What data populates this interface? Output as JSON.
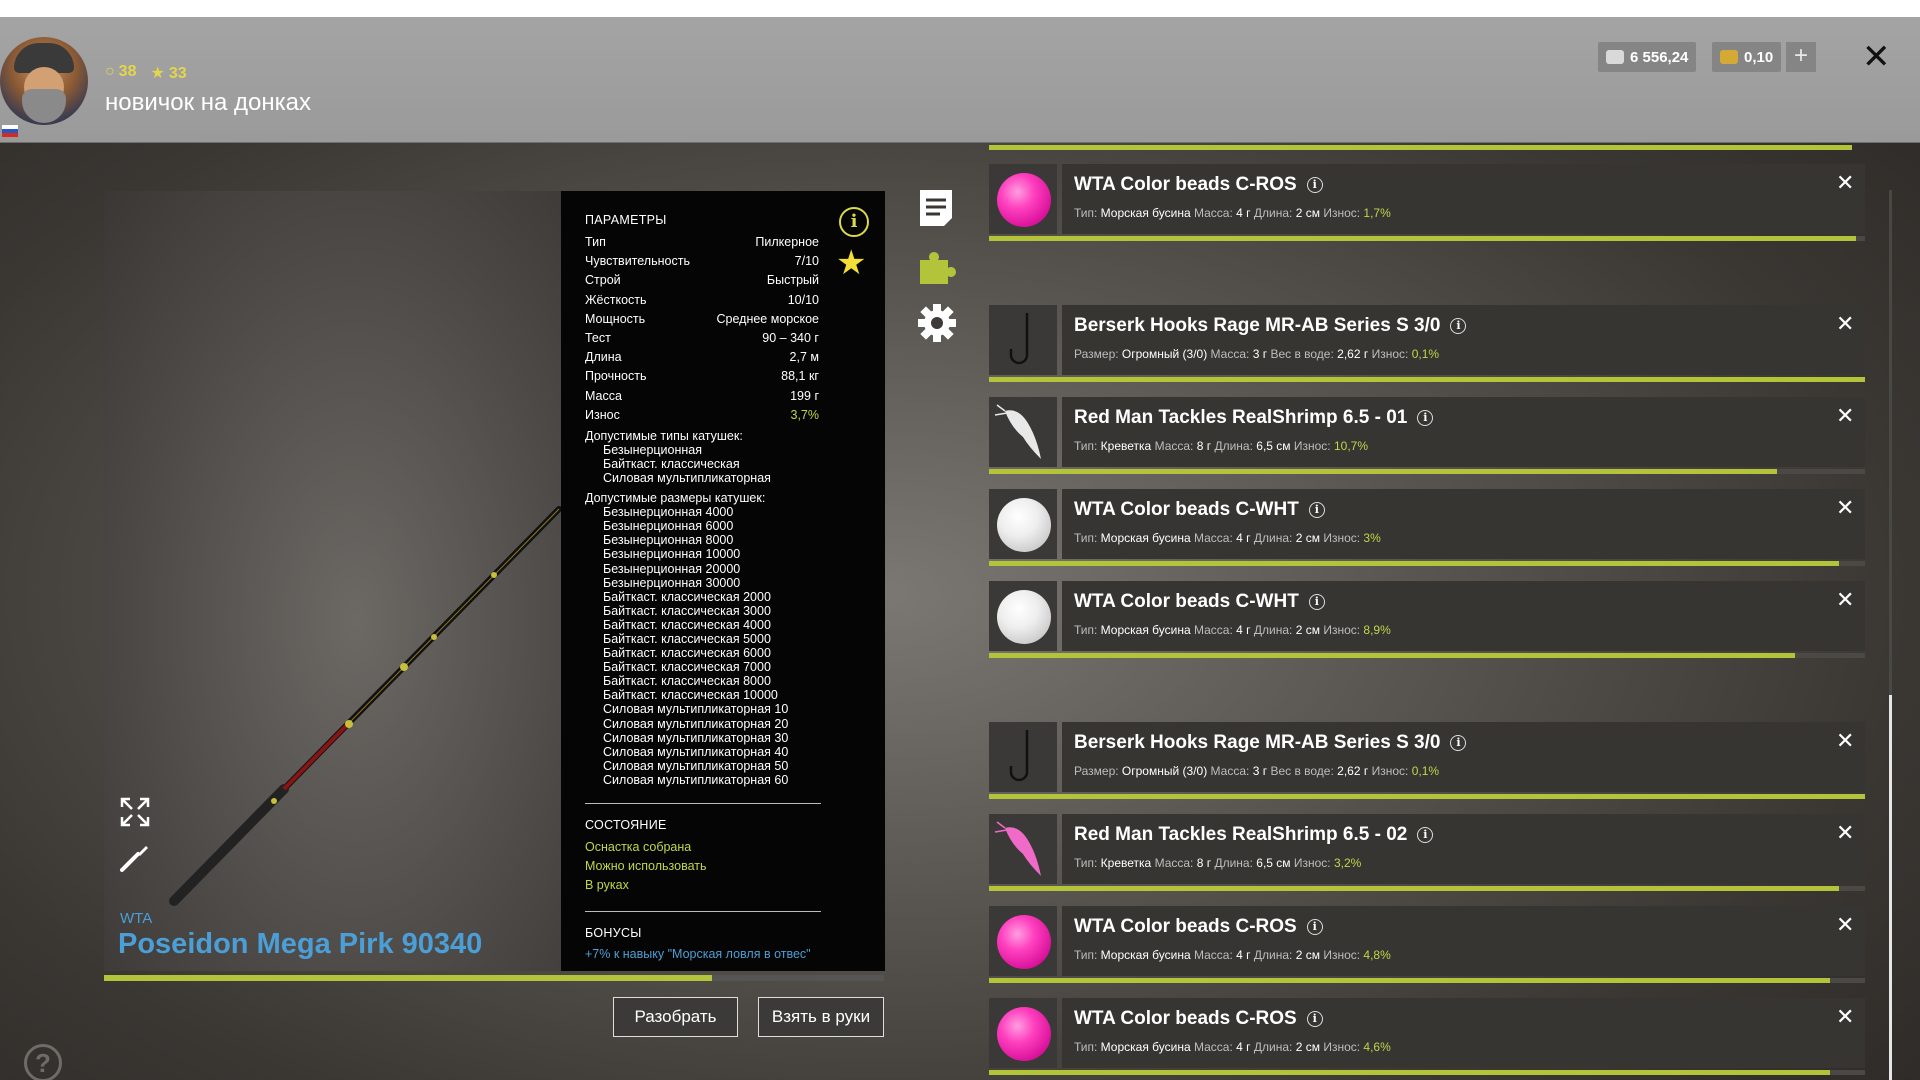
{
  "header": {
    "level": "38",
    "rank": "33",
    "title": "новичок на донках",
    "silver": "6 556,24",
    "gold": "0,10",
    "plus_label": "+",
    "close_label": "✕"
  },
  "rod": {
    "brand": "WTA",
    "name": "Poseidon Mega Pirk 90340",
    "wear_fraction": 0.78
  },
  "params": {
    "heading": "ПАРАМЕТРЫ",
    "rows": [
      {
        "label": "Тип",
        "value": "Пилкерное"
      },
      {
        "label": "Чувствительность",
        "value": "7/10"
      },
      {
        "label": "Строй",
        "value": "Быстрый"
      },
      {
        "label": "Жёсткость",
        "value": "10/10"
      },
      {
        "label": "Мощность",
        "value": "Среднее морское"
      },
      {
        "label": "Тест",
        "value": "90 – 340 г"
      },
      {
        "label": "Длина",
        "value": "2,7 м"
      },
      {
        "label": "Прочность",
        "value": "88,1 кг"
      },
      {
        "label": "Масса",
        "value": "199 г"
      },
      {
        "label": "Износ",
        "value": "3,7%"
      }
    ],
    "reel_types_label": "Допустимые типы катушек:",
    "reel_types": [
      "Безынерционная",
      "Байткаст. классическая",
      "Силовая мультипликаторная"
    ],
    "reel_sizes_label": "Допустимые размеры катушек:",
    "reel_sizes": [
      "Безынерционная 4000",
      "Безынерционная 6000",
      "Безынерционная 8000",
      "Безынерционная 10000",
      "Безынерционная 20000",
      "Безынерционная 30000",
      "Байткаст. классическая 2000",
      "Байткаст. классическая 3000",
      "Байткаст. классическая 4000",
      "Байткаст. классическая 5000",
      "Байткаст. классическая 6000",
      "Байткаст. классическая 7000",
      "Байткаст. классическая 8000",
      "Байткаст. классическая 10000",
      "Силовая мультипликаторная 10",
      "Силовая мультипликаторная 20",
      "Силовая мультипликаторная 30",
      "Силовая мультипликаторная 40",
      "Силовая мультипликаторная 50",
      "Силовая мультипликаторная 60"
    ],
    "status_heading": "СОСТОЯНИЕ",
    "status": [
      "Оснастка собрана",
      "Можно использовать",
      "В руках"
    ],
    "bonus_heading": "БОНУСЫ",
    "bonus": "+7% к навыку \"Морская ловля в отвес\""
  },
  "buttons": {
    "disassemble": "Разобрать",
    "take": "Взять в руки"
  },
  "items": [
    {
      "name": "WTA Color beads C-ROS",
      "thumb": "pink-bead",
      "props": [
        {
          "k": "Тип:",
          "v": "Морская бусина"
        },
        {
          "k": "Масса:",
          "v": "4 г"
        },
        {
          "k": "Длина:",
          "v": "2 см"
        }
      ],
      "wear_label": "Износ:",
      "wear": "1,7%",
      "bar_fraction": 0.99
    },
    {
      "name": "Berserk Hooks Rage MR-AB Series S 3/0",
      "thumb": "hook",
      "props": [
        {
          "k": "Размер:",
          "v": "Огромный (3/0)"
        },
        {
          "k": "Масса:",
          "v": "3 г"
        },
        {
          "k": "Вес в воде:",
          "v": "2,62 г"
        }
      ],
      "wear_label": "Износ:",
      "wear": "0,1%",
      "bar_fraction": 1.0
    },
    {
      "name": "Red Man Tackles RealShrimp 6.5 - 01",
      "thumb": "shrimp-white",
      "props": [
        {
          "k": "Тип:",
          "v": "Креветка"
        },
        {
          "k": "Масса:",
          "v": "8 г"
        },
        {
          "k": "Длина:",
          "v": "6,5 см"
        }
      ],
      "wear_label": "Износ:",
      "wear": "10,7%",
      "bar_fraction": 0.9
    },
    {
      "name": "WTA Color beads C-WHT",
      "thumb": "white-bead",
      "props": [
        {
          "k": "Тип:",
          "v": "Морская бусина"
        },
        {
          "k": "Масса:",
          "v": "4 г"
        },
        {
          "k": "Длина:",
          "v": "2 см"
        }
      ],
      "wear_label": "Износ:",
      "wear": "3%",
      "bar_fraction": 0.97
    },
    {
      "name": "WTA Color beads C-WHT",
      "thumb": "white-bead",
      "props": [
        {
          "k": "Тип:",
          "v": "Морская бусина"
        },
        {
          "k": "Масса:",
          "v": "4 г"
        },
        {
          "k": "Длина:",
          "v": "2 см"
        }
      ],
      "wear_label": "Износ:",
      "wear": "8,9%",
      "bar_fraction": 0.92
    },
    {
      "name": "Berserk Hooks Rage MR-AB Series S 3/0",
      "thumb": "hook",
      "props": [
        {
          "k": "Размер:",
          "v": "Огромный (3/0)"
        },
        {
          "k": "Масса:",
          "v": "3 г"
        },
        {
          "k": "Вес в воде:",
          "v": "2,62 г"
        }
      ],
      "wear_label": "Износ:",
      "wear": "0,1%",
      "bar_fraction": 1.0
    },
    {
      "name": "Red Man Tackles RealShrimp 6.5 - 02",
      "thumb": "shrimp-pink",
      "props": [
        {
          "k": "Тип:",
          "v": "Креветка"
        },
        {
          "k": "Масса:",
          "v": "8 г"
        },
        {
          "k": "Длина:",
          "v": "6,5 см"
        }
      ],
      "wear_label": "Износ:",
      "wear": "3,2%",
      "bar_fraction": 0.97
    },
    {
      "name": "WTA Color beads C-ROS",
      "thumb": "pink-bead",
      "props": [
        {
          "k": "Тип:",
          "v": "Морская бусина"
        },
        {
          "k": "Масса:",
          "v": "4 г"
        },
        {
          "k": "Длина:",
          "v": "2 см"
        }
      ],
      "wear_label": "Износ:",
      "wear": "4,8%",
      "bar_fraction": 0.96
    },
    {
      "name": "WTA Color beads C-ROS",
      "thumb": "pink-bead",
      "props": [
        {
          "k": "Тип:",
          "v": "Морская бусина"
        },
        {
          "k": "Масса:",
          "v": "4 г"
        },
        {
          "k": "Длина:",
          "v": "2 см"
        }
      ],
      "wear_label": "Износ:",
      "wear": "4,6%",
      "bar_fraction": 0.96
    }
  ],
  "help_label": "?",
  "colors": {
    "accent": "#b3c43a",
    "link": "#4b9fd6",
    "wear_good": "#c2d54a"
  }
}
